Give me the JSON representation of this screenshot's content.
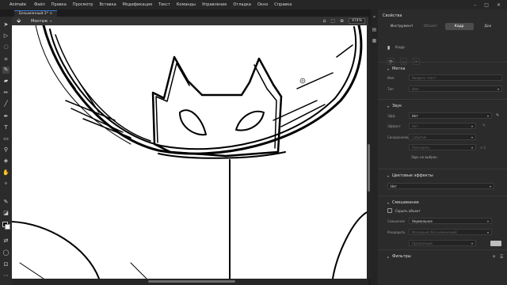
{
  "menubar": {
    "app": "Animate",
    "items": [
      "Файл",
      "Правка",
      "Просмотр",
      "Вставка",
      "Модификация",
      "Текст",
      "Команды",
      "Управление",
      "Отладка",
      "Окно",
      "Справка"
    ]
  },
  "document": {
    "tab_label": "Безымянный-1* ×"
  },
  "scenebar": {
    "scene_label": "Монтаж",
    "zoom_value": "474%"
  },
  "properties": {
    "title": "Свойства",
    "tabs": [
      "Инструмент",
      "Объект",
      "Кадр",
      "Док"
    ],
    "frame_label": "Кадр",
    "label_section": {
      "title": "Метка",
      "name_label": "Имя",
      "name_placeholder": "Введите текст",
      "type_label": "Тип",
      "type_value": "Имя"
    },
    "sound_section": {
      "title": "Звук",
      "effect_label": "Эфф.",
      "effect_value": "Нет",
      "sync_label": "Эффект",
      "sync_value": "Нет",
      "sync_mode_label": "Синхронизация",
      "sync_mode_value": "Событие",
      "repeat_value": "Повторить",
      "repeat_count": "× 1",
      "no_sound": "Звук не выбран"
    },
    "color_section": {
      "title": "Цветовые эффекты",
      "value": "Нет"
    },
    "blend_section": {
      "title": "Смешивание",
      "hide_object": "Скрыть объект",
      "blend_label": "Смешение",
      "blend_value": "Нормальное",
      "render_label": "Рендерить",
      "render_value": "Исходный (без изменений)",
      "render_sub": "Прозрачный"
    },
    "filters_section": {
      "title": "Фильтры"
    }
  },
  "colors": {
    "accent": "#3a7bd5",
    "panel_bg": "#2b2b2b",
    "canvas": "#ffffff"
  }
}
